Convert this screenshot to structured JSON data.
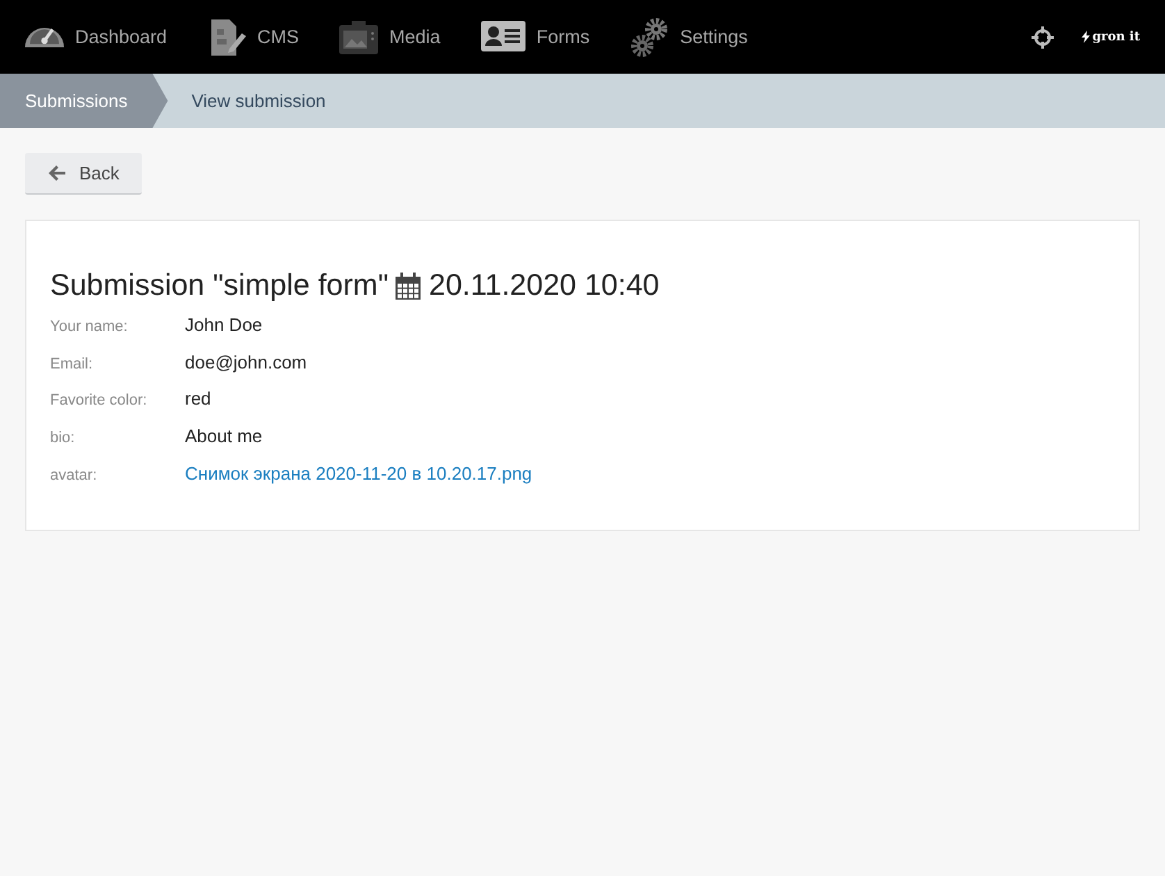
{
  "nav": {
    "items": [
      {
        "label": "Dashboard"
      },
      {
        "label": "CMS"
      },
      {
        "label": "Media"
      },
      {
        "label": "Forms"
      },
      {
        "label": "Settings"
      }
    ],
    "logo": "gron it"
  },
  "breadcrumbs": [
    {
      "label": "Submissions",
      "selected": false
    },
    {
      "label": "View submission",
      "selected": true
    }
  ],
  "back_button": "Back",
  "submission": {
    "title": "Submission \"simple form\"",
    "date": "20.11.2020 10:40",
    "fields": [
      {
        "label": "Your name:",
        "value": "John Doe",
        "kind": "text"
      },
      {
        "label": "Email:",
        "value": "doe@john.com",
        "kind": "text"
      },
      {
        "label": "Favorite color:",
        "value": "red",
        "kind": "text"
      },
      {
        "label": "bio:",
        "value": "About me",
        "kind": "text"
      },
      {
        "label": "avatar:",
        "value": "Снимок экрана 2020-11-20 в 10.20.17.png",
        "kind": "link"
      }
    ]
  }
}
